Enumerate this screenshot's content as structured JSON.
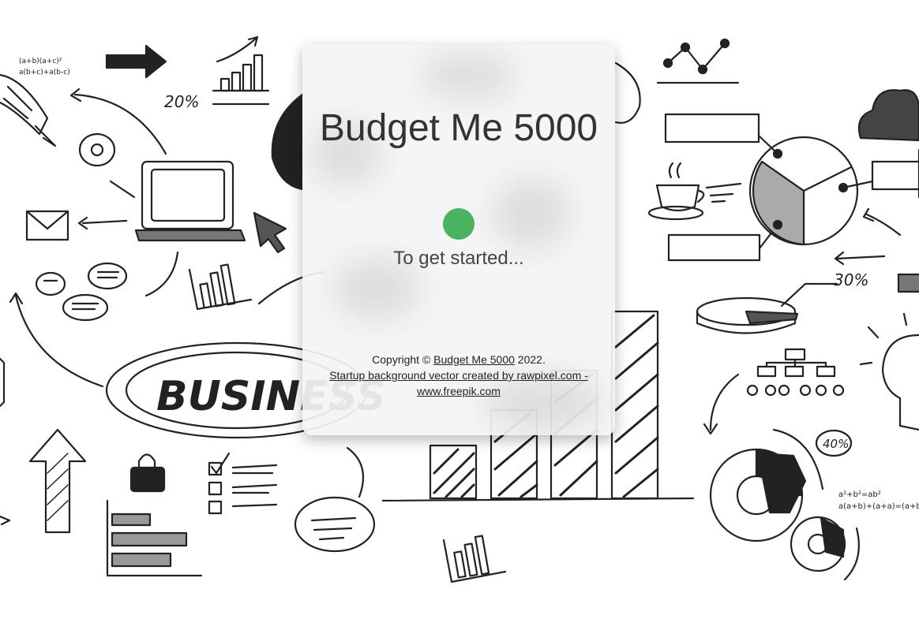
{
  "app": {
    "title": "Budget Me 5000",
    "subtitle": "To get started..."
  },
  "footer": {
    "copyright_prefix": "Copyright ©",
    "brand_link": "Budget Me 5000",
    "year_suffix": "2022.",
    "credit_link": "Startup background vector created by rawpixel.com - www.freepik.com"
  },
  "background": {
    "labels": {
      "business": "BUSINESS",
      "pct20": "20%",
      "pct30": "30%",
      "pct40": "40%",
      "formula1": "(a+b)(a+c)²",
      "formula2": "a(b+c)+a(b-c)",
      "formula3": "a²+b²=ab²",
      "formula4": "a(a+b)+(a+a)=(a+b)"
    }
  },
  "colors": {
    "accent": "#4cb263",
    "ink": "#222222"
  }
}
